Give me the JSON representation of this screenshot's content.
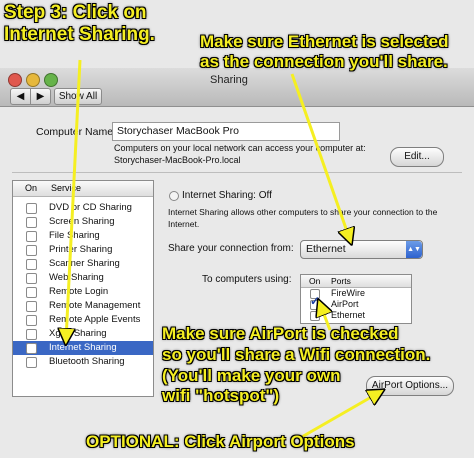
{
  "window": {
    "title": "Sharing",
    "back_label": "◀",
    "forward_label": "▶",
    "show_all_label": "Show All"
  },
  "computer": {
    "name_label": "Computer Name:",
    "name_value": "Storychaser MacBook Pro",
    "info_line1": "Computers on your local network can access your computer at:",
    "info_line2": "Storychaser-MacBook-Pro.local",
    "edit_label": "Edit..."
  },
  "services": {
    "col_on": "On",
    "col_service": "Service",
    "items": [
      {
        "label": "DVD or CD Sharing",
        "checked": false
      },
      {
        "label": "Screen Sharing",
        "checked": false
      },
      {
        "label": "File Sharing",
        "checked": false
      },
      {
        "label": "Printer Sharing",
        "checked": false
      },
      {
        "label": "Scanner Sharing",
        "checked": false
      },
      {
        "label": "Web Sharing",
        "checked": false
      },
      {
        "label": "Remote Login",
        "checked": false
      },
      {
        "label": "Remote Management",
        "checked": false
      },
      {
        "label": "Remote Apple Events",
        "checked": false
      },
      {
        "label": "Xgrid Sharing",
        "checked": false
      },
      {
        "label": "Internet Sharing",
        "checked": false,
        "selected": true
      },
      {
        "label": "Bluetooth Sharing",
        "checked": false
      }
    ]
  },
  "internet_sharing": {
    "status": "Internet Sharing: Off",
    "desc_line1": "Internet Sharing allows other computers to share your connection to the",
    "desc_line2": "Internet.",
    "share_from_label": "Share your connection from:",
    "share_from_value": "Ethernet",
    "to_computers_label": "To computers using:",
    "ports_col_on": "On",
    "ports_col_ports": "Ports",
    "ports": [
      {
        "label": "FireWire",
        "checked": false
      },
      {
        "label": "AirPort",
        "checked": true
      },
      {
        "label": "Ethernet",
        "checked": false
      }
    ],
    "airport_options_label": "AirPort Options..."
  },
  "annotations": {
    "step3_line1": "Step 3: Click on",
    "step3_line2": "Internet Sharing.",
    "ethernet_line1": "Make sure Ethernet is selected",
    "ethernet_line2": "as the connection you'll share.",
    "airport_line1": "Make sure AirPort is checked",
    "airport_line2": "so you'll share a Wifi connection.",
    "airport_line3": "(You'll make your own",
    "airport_line4": "wifi \"hotspot\")",
    "optional": "OPTIONAL: Click Airport Options"
  },
  "colors": {
    "annotation": "#f5ef22",
    "selection": "#3a67c4",
    "popup_accent": "#2d62cf"
  }
}
